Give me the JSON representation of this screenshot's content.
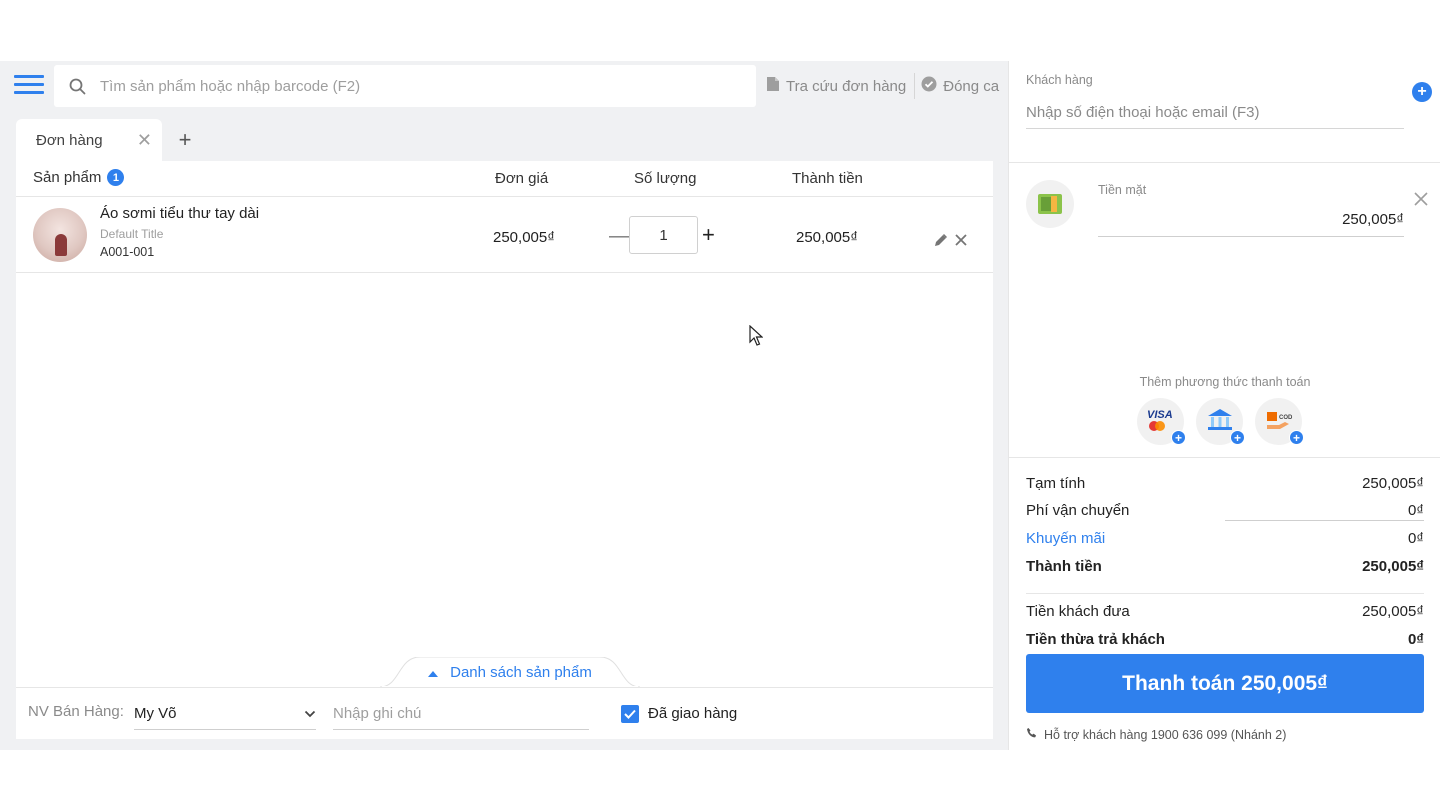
{
  "header": {
    "search_placeholder": "Tìm sản phẩm hoặc nhập barcode (F2)",
    "lookup_label": "Tra cứu đơn hàng",
    "close_shift_label": "Đóng ca"
  },
  "tabs": [
    {
      "label": "Đơn hàng"
    }
  ],
  "table": {
    "col_product": "Sản phẩm",
    "product_count": "1",
    "col_price": "Đơn giá",
    "col_qty": "Số lượng",
    "col_total": "Thành tiền",
    "rows": [
      {
        "name": "Áo sơmi tiểu thư tay dài",
        "variant": "Default Title",
        "sku": "A001-001",
        "price": "250,005₫",
        "qty": "1",
        "total": "250,005₫"
      }
    ]
  },
  "product_list_toggle": "Danh sách sản phẩm",
  "footer": {
    "staff_label": "NV Bán Hàng:",
    "staff_value": "My Võ",
    "note_placeholder": "Nhập ghi chú",
    "delivered_label": "Đã giao hàng",
    "delivered_checked": true
  },
  "customer": {
    "label": "Khách hàng",
    "placeholder": "Nhập số điện thoại hoặc email (F3)"
  },
  "payment": {
    "cash_label": "Tiền mặt",
    "cash_value": "250,005₫",
    "add_methods_label": "Thêm phương thức thanh toán",
    "methods": [
      "card-icon",
      "bank-transfer-icon",
      "cod-icon"
    ]
  },
  "summary": {
    "subtotal_label": "Tạm tính",
    "subtotal_value": "250,005₫",
    "shipping_label": "Phí vận chuyển",
    "shipping_value": "0₫",
    "discount_label": "Khuyến mãi",
    "discount_value": "0₫",
    "total_label": "Thành tiền",
    "total_value": "250,005₫",
    "paid_label": "Tiền khách đưa",
    "paid_value": "250,005₫",
    "change_label": "Tiền thừa trả khách",
    "change_value": "0₫"
  },
  "checkout_label": "Thanh toán 250,005₫",
  "support_text": "Hỗ trợ khách hàng 1900 636 099 (Nhánh 2)",
  "colors": {
    "accent": "#2f80ed",
    "panel_bg": "#f0f1f3"
  }
}
